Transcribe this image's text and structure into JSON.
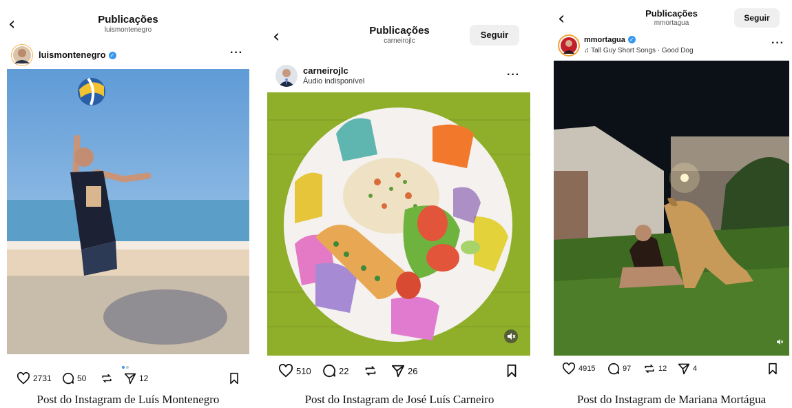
{
  "posts": [
    {
      "header_title": "Publicações",
      "header_subtitle": "luismontenegro",
      "username": "luismontenegro",
      "verified": true,
      "likes": "2731",
      "comments": "50",
      "reposts": "",
      "shares": "12",
      "caption": "Post do Instagram de Luís Montenegro"
    },
    {
      "header_title": "Publicações",
      "header_subtitle": "carneirojlc",
      "follow_label": "Seguir",
      "username": "carneirojlc",
      "user_subtitle": "Áudio indisponível",
      "likes": "510",
      "comments": "22",
      "shares": "26",
      "caption": "Post do Instagram de José Luís Carneiro"
    },
    {
      "header_title": "Publicações",
      "header_subtitle": "mmortagua",
      "follow_label": "Seguir",
      "username": "mmortagua",
      "verified": true,
      "user_subtitle": "Tall Guy Short Songs · Good Dog",
      "likes": "4915",
      "comments": "97",
      "reposts": "12",
      "shares": "4",
      "caption": "Post do Instagram de Mariana Mortágua"
    }
  ],
  "icons": {
    "back": "chevron-left-icon",
    "more": "more-horizontal-icon",
    "like": "heart-icon",
    "comment": "comment-icon",
    "repost": "repost-icon",
    "share": "send-icon",
    "save": "bookmark-icon",
    "verified": "verified-badge-icon",
    "music": "music-note-icon",
    "mute": "muted-speaker-icon"
  },
  "colors": {
    "verified": "#3897f0",
    "follow_bg": "#efefef"
  }
}
